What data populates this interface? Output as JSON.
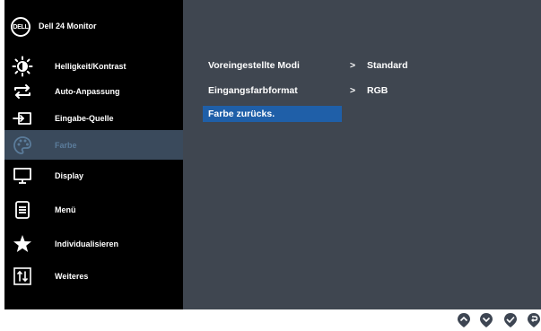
{
  "header": {
    "logo_text": "DELL",
    "model": "Dell 24 Monitor"
  },
  "sidebar": {
    "items": [
      {
        "label": "Helligkeit/Kontrast",
        "icon": "brightness-icon"
      },
      {
        "label": "Auto-Anpassung",
        "icon": "auto-adjust-icon"
      },
      {
        "label": "Eingabe-Quelle",
        "icon": "input-source-icon"
      },
      {
        "label": "Farbe",
        "icon": "color-palette-icon",
        "active": true
      },
      {
        "label": "Display",
        "icon": "display-icon"
      },
      {
        "label": "Menü",
        "icon": "menu-icon"
      },
      {
        "label": "Individualisieren",
        "icon": "star-icon"
      },
      {
        "label": "Weiteres",
        "icon": "others-icon"
      }
    ]
  },
  "content": {
    "rows": [
      {
        "label": "Voreingestellte Modi",
        "arrow": ">",
        "value": "Standard"
      },
      {
        "label": "Eingangsfarbformat",
        "arrow": ">",
        "value": "RGB"
      },
      {
        "label": "Farbe zurücks.",
        "selected": true
      }
    ]
  },
  "colors": {
    "osd_background": "#000000",
    "content_background": "#3f4650",
    "active_item_background": "#3a4a5c",
    "active_item_text": "#5b7c9b",
    "selection_blue": "#1f5fa8"
  },
  "buttons": [
    {
      "icon": "up-button-icon"
    },
    {
      "icon": "down-button-icon"
    },
    {
      "icon": "confirm-button-icon"
    },
    {
      "icon": "back-button-icon"
    }
  ]
}
